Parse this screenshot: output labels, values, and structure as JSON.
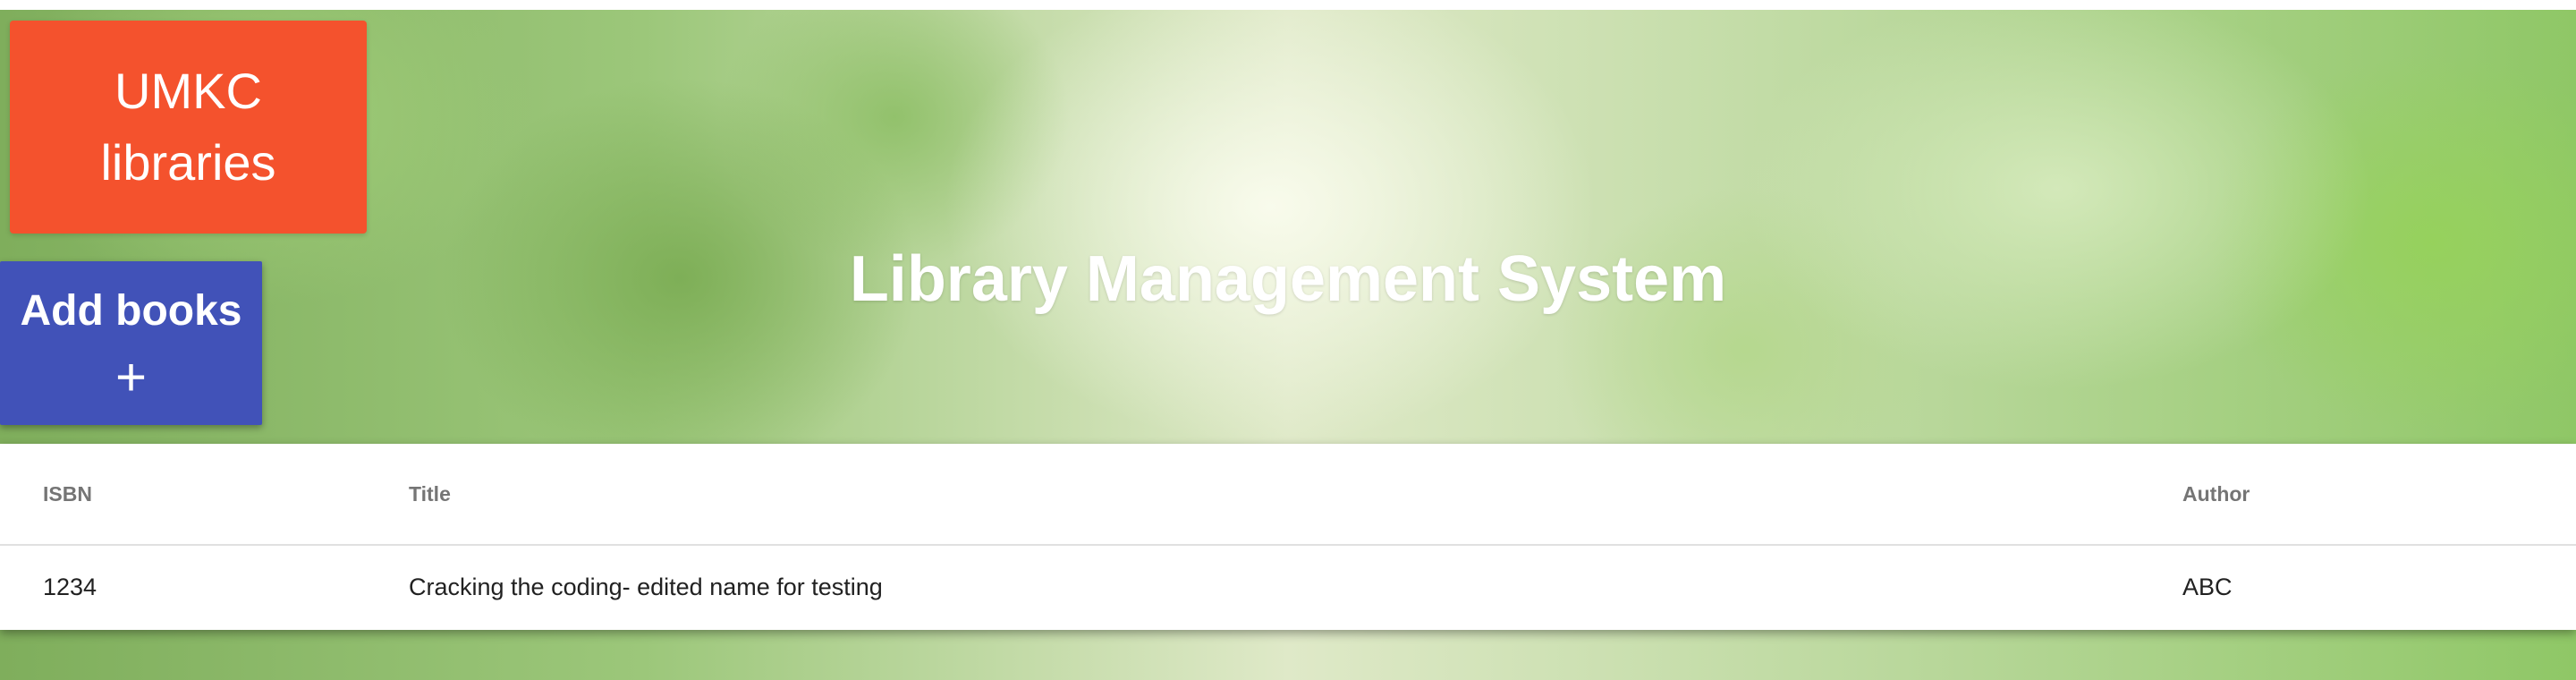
{
  "brand": {
    "line1": "UMKC",
    "line2": "libraries",
    "color": "#f4522d"
  },
  "add_books": {
    "label": "Add books",
    "icon": "plus-icon",
    "icon_glyph": "+",
    "color": "#4152b8"
  },
  "hero": {
    "title": "Library Management System"
  },
  "table": {
    "headers": {
      "isbn": "ISBN",
      "title": "Title",
      "author": "Author"
    },
    "rows": [
      {
        "isbn": "1234",
        "title": "Cracking the coding- edited name for testing",
        "author": "ABC"
      }
    ]
  }
}
